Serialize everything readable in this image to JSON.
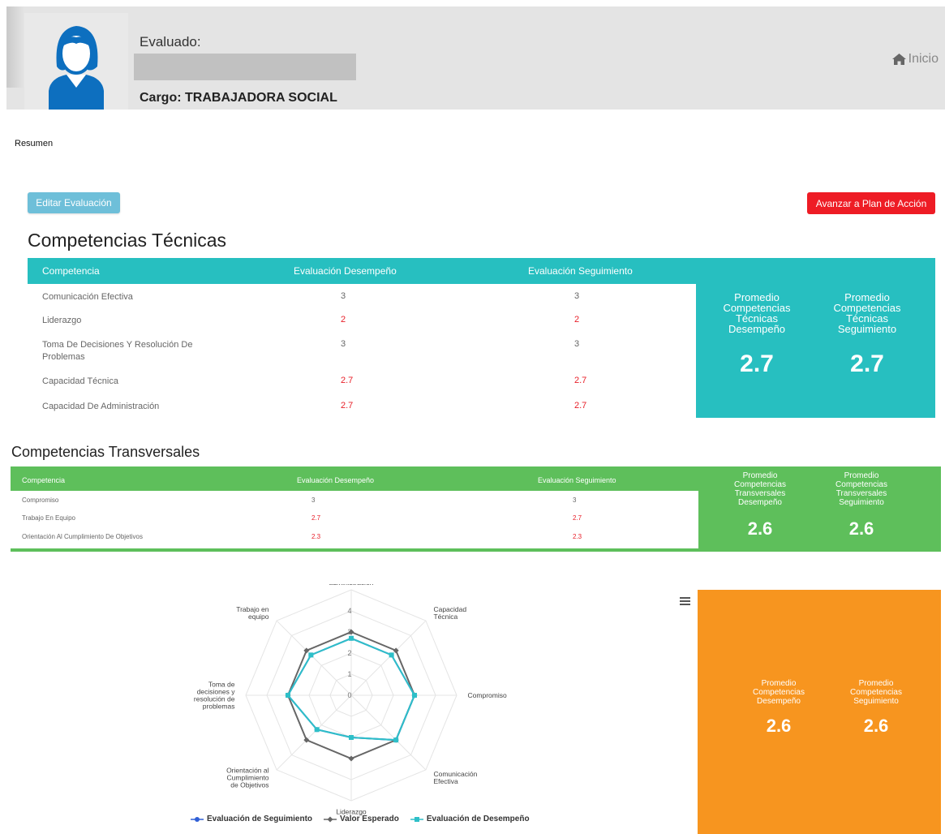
{
  "header": {
    "evaluated_label": "Evaluado:",
    "position": "Cargo: TRABAJADORA SOCIAL",
    "home_link": "Inicio"
  },
  "summary_label": "Resumen",
  "buttons": {
    "edit": "Editar Evaluación",
    "plan": "Avanzar a Plan de Acción"
  },
  "technical": {
    "title": "Competencias Técnicas",
    "columns": [
      "Competencia",
      "Evaluación Desempeño",
      "Evaluación Seguimiento"
    ],
    "rows": [
      {
        "name": "Comunicación Efectiva",
        "d": "3",
        "s": "3"
      },
      {
        "name": "Liderazgo",
        "d": "2",
        "s": "2"
      },
      {
        "name": "Toma De Decisiones Y Resolución De Problemas",
        "d": "3",
        "s": "3"
      },
      {
        "name": "Capacidad Técnica",
        "d": "2.7",
        "s": "2.7"
      },
      {
        "name": "Capacidad De Administración",
        "d": "2.7",
        "s": "2.7"
      }
    ],
    "avg_d_label": "Promedio Competencias Técnicas Desempeño",
    "avg_d": "2.7",
    "avg_s_label": "Promedio Competencias Técnicas Seguimiento",
    "avg_s": "2.7"
  },
  "transversal": {
    "title": "Competencias Transversales",
    "columns": [
      "Competencia",
      "Evaluación Desempeño",
      "Evaluación Seguimiento"
    ],
    "rows": [
      {
        "name": "Compromiso",
        "d": "3",
        "s": "3"
      },
      {
        "name": "Trabajo En Equipo",
        "d": "2.7",
        "s": "2.7"
      },
      {
        "name": "Orientación Al Cumplimiento De Objetivos",
        "d": "2.3",
        "s": "2.3"
      }
    ],
    "avg_d_label": "Promedio Competencias Transversales Desempeño",
    "avg_d": "2.6",
    "avg_s_label": "Promedio Competencias Transversales Seguimiento",
    "avg_s": "2.6"
  },
  "overall": {
    "avg_d_label": "Promedio Competencias Desempeño",
    "avg_d": "2.6",
    "avg_s_label": "Promedio Competencias Seguimiento",
    "avg_s": "2.6"
  },
  "colors": {
    "teal": "#27bfc0",
    "green": "#5ebf5b",
    "orange": "#f7951f",
    "red": "#ee1c25",
    "low_value": "#e8202a"
  },
  "chart_data": {
    "type": "radar",
    "axes": [
      "Capacidad de administración",
      "Capacidad Técnica",
      "Compromiso",
      "Comunicación Efectiva",
      "Liderazgo",
      "Orientación al Cumplimiento de Objetivos",
      "Toma de decisiones y resolución de problemas",
      "Trabajo en equipo"
    ],
    "axis_labels_lines": [
      [
        "Capacidad de",
        "administración"
      ],
      [
        "Capacidad",
        "Técnica"
      ],
      [
        "Compromiso"
      ],
      [
        "Comunicación",
        "Efectiva"
      ],
      [
        "Liderazgo"
      ],
      [
        "Orientación al",
        "Cumplimiento",
        "de Objetivos"
      ],
      [
        "Toma de",
        "decisiones y",
        "resolución de",
        "problemas"
      ],
      [
        "Trabajo en",
        "equipo"
      ]
    ],
    "ticks": [
      "0",
      "1",
      "2",
      "3",
      "4"
    ],
    "range": [
      0,
      4
    ],
    "series": [
      {
        "name": "Evaluación de Seguimiento",
        "color": "#2f5fd6",
        "marker": "circle",
        "values": [
          2.7,
          2.7,
          3,
          3,
          2,
          2.3,
          3,
          2.7
        ]
      },
      {
        "name": "Valor Esperado",
        "color": "#666666",
        "marker": "diamond",
        "values": [
          3,
          3,
          3,
          3,
          3,
          3,
          3,
          3
        ]
      },
      {
        "name": "Evaluación de Desempeño",
        "color": "#2ebfc8",
        "marker": "square",
        "values": [
          2.7,
          2.7,
          3,
          3,
          2,
          2.3,
          3,
          2.7
        ]
      }
    ],
    "legend_position": "bottom"
  }
}
